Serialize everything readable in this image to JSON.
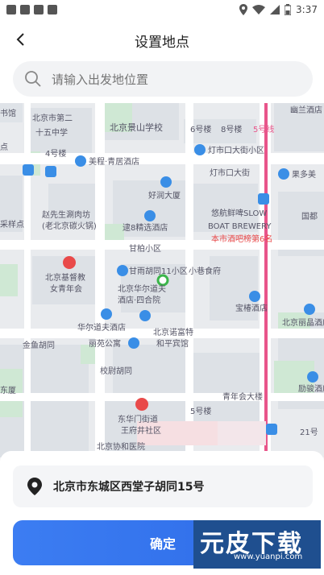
{
  "status_bar": {
    "time": "3:37"
  },
  "header": {
    "title": "设置地点"
  },
  "search": {
    "placeholder": "请输入出发地位置"
  },
  "map": {
    "labels": [
      {
        "text": "书馆"
      },
      {
        "text": "北京市第二"
      },
      {
        "text": "十五中学"
      },
      {
        "text": "北京景山学校"
      },
      {
        "text": "6号楼"
      },
      {
        "text": "8号楼"
      },
      {
        "text": "5号线"
      },
      {
        "text": "幽兰酒店"
      },
      {
        "text": "点"
      },
      {
        "text": "4号楼"
      },
      {
        "text": "美程·青居酒店"
      },
      {
        "text": "灯市口大街小区"
      },
      {
        "text": "灯市口大街"
      },
      {
        "text": "果多美"
      },
      {
        "text": "好润大厦"
      },
      {
        "text": "赵先生涮肉坊"
      },
      {
        "text": "(老北京碳火锅)"
      },
      {
        "text": "逮8精选酒店"
      },
      {
        "text": "采样点"
      },
      {
        "text": "悠航鲜啤SLOW"
      },
      {
        "text": "BOAT BREWERY"
      },
      {
        "text": "本市酒吧榜第6名"
      },
      {
        "text": "国都"
      },
      {
        "text": "甘柏小区"
      },
      {
        "text": "甘雨胡同11小区"
      },
      {
        "text": "小巷食府"
      },
      {
        "text": "北京基督教"
      },
      {
        "text": "女青年会"
      },
      {
        "text": "北京华尔道夫"
      },
      {
        "text": "酒店·四合院"
      },
      {
        "text": "宝椿酒店"
      },
      {
        "text": "北京丽晶酒店"
      },
      {
        "text": "北京诺富特"
      },
      {
        "text": "和平宾馆"
      },
      {
        "text": "华尔道夫酒店"
      },
      {
        "text": "丽苑公寓"
      },
      {
        "text": "金鱼胡同"
      },
      {
        "text": "校尉胡同"
      },
      {
        "text": "东厦"
      },
      {
        "text": "东华门街道"
      },
      {
        "text": "王府井社区"
      },
      {
        "text": "5号楼"
      },
      {
        "text": "青年会大楼"
      },
      {
        "text": "励骏酒店"
      },
      {
        "text": "北京协和医院"
      },
      {
        "text": "21号"
      }
    ]
  },
  "bottom": {
    "address": "北京市东城区西堂子胡同15号",
    "confirm_label": "确定"
  },
  "watermark": {
    "big": "元皮下载",
    "small": "www.yuanpi.com"
  },
  "colors": {
    "accent": "#3278f0",
    "metro": "#e8558a",
    "poi_blue": "#3a8ee6",
    "poi_red": "#e94a4a"
  }
}
